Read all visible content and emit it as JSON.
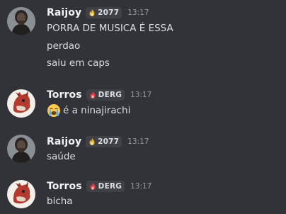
{
  "messages": [
    {
      "author": "Raijoy",
      "tag": "2077",
      "tag_icon": "flame-icon",
      "tag_color": "#f0b232",
      "time": "13:17",
      "lines": [
        "PORRA DE MUSICA É ESSA",
        "perdao",
        "saiu em caps"
      ]
    },
    {
      "author": "Torros",
      "tag": "DERG",
      "tag_icon": "flame-icon",
      "tag_color": "#f23f43",
      "time": "13:17",
      "lines": [
        "é a ninajirachi"
      ],
      "emoji": "loudly-crying-face-icon"
    },
    {
      "author": "Raijoy",
      "tag": "2077",
      "tag_icon": "flame-icon",
      "tag_color": "#f0b232",
      "time": "13:17",
      "lines": [
        "saúde"
      ]
    },
    {
      "author": "Torros",
      "tag": "DERG",
      "tag_icon": "flame-icon",
      "tag_color": "#f23f43",
      "time": "13:17",
      "lines": [
        "bicha"
      ]
    }
  ],
  "colors": {
    "background": "#313338",
    "username": "#f2f3f5",
    "text": "#dbdee1",
    "timestamp": "#949ba4"
  }
}
